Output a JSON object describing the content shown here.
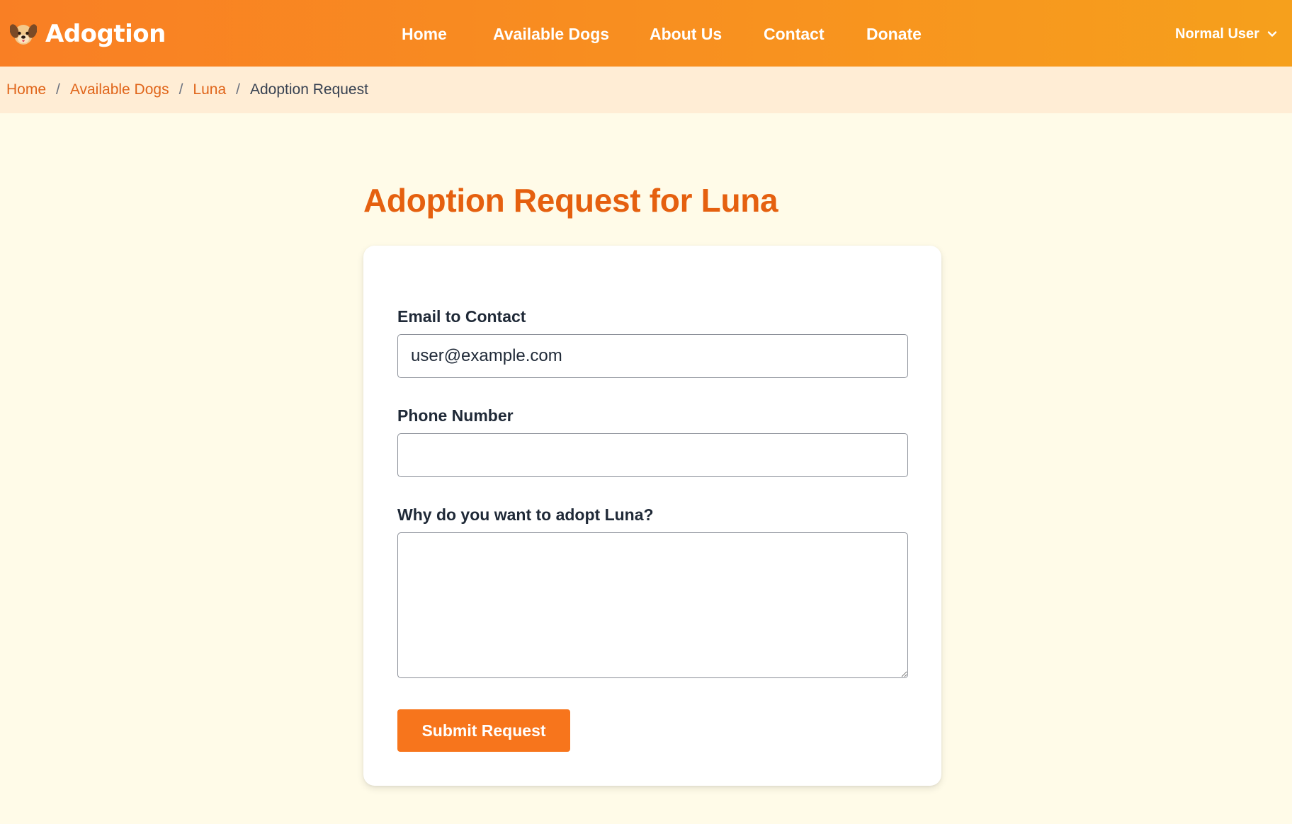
{
  "brand": {
    "name": "Adogtion",
    "icon": "dog-face-icon"
  },
  "nav": {
    "items": [
      {
        "label": "Home"
      },
      {
        "label": "Available Dogs"
      },
      {
        "label": "About Us"
      },
      {
        "label": "Contact"
      },
      {
        "label": "Donate"
      }
    ],
    "user_label": "Normal User"
  },
  "breadcrumb": {
    "items": [
      "Home",
      "Available Dogs",
      "Luna"
    ],
    "separator": "/",
    "current": "Adoption Request"
  },
  "page": {
    "title": "Adoption Request for Luna"
  },
  "form": {
    "email_label": "Email to Contact",
    "email_value": "user@example.com",
    "phone_label": "Phone Number",
    "phone_value": "",
    "reason_label": "Why do you want to adopt Luna?",
    "reason_value": "",
    "submit_label": "Submit Request"
  },
  "colors": {
    "header_gradient_start": "#f97f24",
    "header_gradient_end": "#f6a01c",
    "accent": "#e5600f",
    "button": "#f7751c",
    "breadcrumb_bg": "#ffedd5",
    "page_bg": "#fffbe8"
  }
}
